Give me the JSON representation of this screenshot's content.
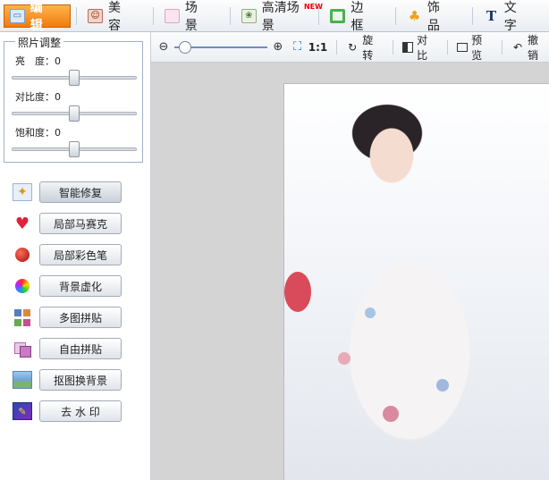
{
  "top_tabs": [
    {
      "label": "编 辑",
      "icon": "image-edit-icon",
      "active": true
    },
    {
      "label": "美 容",
      "icon": "face-beauty-icon",
      "active": false
    },
    {
      "label": "场 景",
      "icon": "scene-icon",
      "active": false
    },
    {
      "label": "高清场景",
      "icon": "hd-scene-icon",
      "active": false,
      "badge": "NEW"
    },
    {
      "label": "边 框",
      "icon": "frame-icon",
      "active": false
    },
    {
      "label": "饰 品",
      "icon": "clover-icon",
      "active": false
    },
    {
      "label": "文 字",
      "icon": "text-icon",
      "active": false
    }
  ],
  "adjust": {
    "title": "照片调整",
    "brightness": {
      "label": "亮　度：",
      "value": "0",
      "level": 0.5
    },
    "contrast": {
      "label": "对比度：",
      "value": "0",
      "level": 0.5
    },
    "saturation": {
      "label": "饱和度：",
      "value": "0",
      "level": 0.5
    }
  },
  "tools": [
    {
      "label": "智能修复",
      "icon": "magic-wand-icon",
      "active": true
    },
    {
      "label": "局部马赛克",
      "icon": "mosaic-heart-icon",
      "active": false
    },
    {
      "label": "局部彩色笔",
      "icon": "apple-icon",
      "active": false
    },
    {
      "label": "背景虚化",
      "icon": "color-blur-icon",
      "active": false
    },
    {
      "label": "多图拼贴",
      "icon": "collage-grid-icon",
      "active": false
    },
    {
      "label": "自由拼贴",
      "icon": "free-collage-icon",
      "active": false
    },
    {
      "label": "抠图换背景",
      "icon": "cutout-icon",
      "active": false
    },
    {
      "label": "去 水 印",
      "icon": "watermark-icon",
      "active": false
    }
  ],
  "toolbar": {
    "zoom_level": 0.05,
    "ratio": "1:1",
    "rotate": "旋转",
    "compare": "对比",
    "preview": "预览",
    "undo": "撤销"
  }
}
